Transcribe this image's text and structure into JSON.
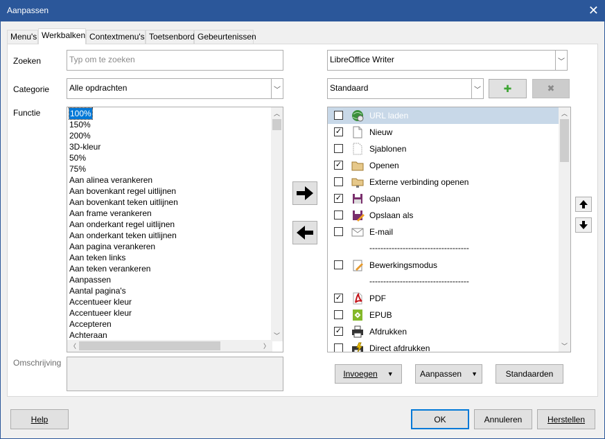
{
  "window": {
    "title": "Aanpassen",
    "close_glyph": "✕"
  },
  "tabs": [
    "Menu's",
    "Werkbalken",
    "Contextmenu's",
    "Toetsenbord",
    "Gebeurtenissen"
  ],
  "left": {
    "search_label": "Zoeken",
    "search_placeholder": "Typ om te zoeken",
    "category_label": "Categorie",
    "category_value": "Alle opdrachten",
    "function_label": "Functie",
    "functions": [
      "100%",
      "150%",
      "200%",
      "3D-kleur",
      "50%",
      "75%",
      "Aan alinea verankeren",
      "Aan bovenkant regel uitlijnen",
      "Aan bovenkant teken uitlijnen",
      "Aan frame verankeren",
      "Aan onderkant regel uitlijnen",
      "Aan onderkant teken uitlijnen",
      "Aan pagina verankeren",
      "Aan teken links",
      "Aan teken verankeren",
      "Aanpassen",
      "Aantal pagina's",
      "Accentueer kleur",
      "Accentueer kleur",
      "Accepteren",
      "Achteraan"
    ],
    "description_label": "Omschrijving"
  },
  "right": {
    "scope_value": "LibreOffice Writer",
    "toolbar_value": "Standaard",
    "add_glyph": "✚",
    "remove_glyph": "✖",
    "entries": [
      {
        "type": "item",
        "checked": false,
        "label": "URL laden",
        "icon": "globe-icon",
        "selected": true
      },
      {
        "type": "item",
        "checked": true,
        "label": "Nieuw",
        "icon": "new-document-icon"
      },
      {
        "type": "item",
        "checked": false,
        "label": "Sjablonen",
        "icon": "templates-icon"
      },
      {
        "type": "item",
        "checked": true,
        "label": "Openen",
        "icon": "folder-icon"
      },
      {
        "type": "item",
        "checked": false,
        "label": "Externe verbinding openen",
        "icon": "remote-folder-icon"
      },
      {
        "type": "item",
        "checked": true,
        "label": "Opslaan",
        "icon": "save-icon"
      },
      {
        "type": "item",
        "checked": false,
        "label": "Opslaan als",
        "icon": "save-as-icon"
      },
      {
        "type": "item",
        "checked": false,
        "label": "E-mail",
        "icon": "email-icon"
      },
      {
        "type": "separator",
        "label": "------------------------------------"
      },
      {
        "type": "item",
        "checked": false,
        "label": "Bewerkingsmodus",
        "icon": "edit-mode-icon"
      },
      {
        "type": "separator",
        "label": "------------------------------------"
      },
      {
        "type": "item",
        "checked": true,
        "label": "PDF",
        "icon": "pdf-icon"
      },
      {
        "type": "item",
        "checked": false,
        "label": "EPUB",
        "icon": "epub-icon"
      },
      {
        "type": "item",
        "checked": true,
        "label": "Afdrukken",
        "icon": "printer-icon"
      },
      {
        "type": "item",
        "checked": false,
        "label": "Direct afdrukken",
        "icon": "direct-print-icon"
      }
    ],
    "insert_label": "Invoegen",
    "modify_label": "Aanpassen",
    "defaults_label": "Standaarden",
    "check_glyph": "✓"
  },
  "footer": {
    "help": "Help",
    "ok": "OK",
    "cancel": "Annuleren",
    "reset": "Herstellen"
  }
}
